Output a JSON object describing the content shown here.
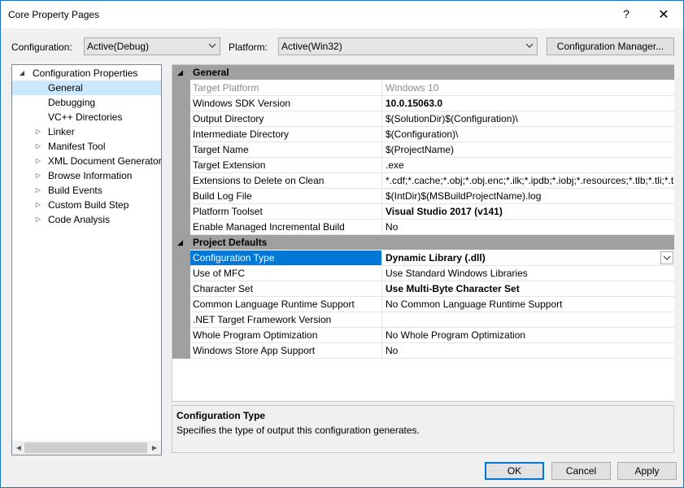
{
  "window": {
    "title": "Core Property Pages",
    "help_glyph": "?",
    "close_glyph": "✕"
  },
  "toolbar": {
    "configuration_label": "Configuration:",
    "configuration_value": "Active(Debug)",
    "platform_label": "Platform:",
    "platform_value": "Active(Win32)",
    "config_manager_label": "Configuration Manager..."
  },
  "tree": {
    "root": "Configuration Properties",
    "items": [
      {
        "label": "General",
        "selected": true,
        "expandable": false
      },
      {
        "label": "Debugging",
        "expandable": false
      },
      {
        "label": "VC++ Directories",
        "expandable": false
      },
      {
        "label": "Linker",
        "expandable": true
      },
      {
        "label": "Manifest Tool",
        "expandable": true
      },
      {
        "label": "XML Document Generator",
        "expandable": true
      },
      {
        "label": "Browse Information",
        "expandable": true
      },
      {
        "label": "Build Events",
        "expandable": true
      },
      {
        "label": "Custom Build Step",
        "expandable": true
      },
      {
        "label": "Code Analysis",
        "expandable": true
      }
    ]
  },
  "grid": {
    "categories": [
      {
        "label": "General",
        "rows": [
          {
            "name": "Target Platform",
            "value": "Windows 10",
            "disabled": true
          },
          {
            "name": "Windows SDK Version",
            "value": "10.0.15063.0",
            "bold": true
          },
          {
            "name": "Output Directory",
            "value": "$(SolutionDir)$(Configuration)\\"
          },
          {
            "name": "Intermediate Directory",
            "value": "$(Configuration)\\"
          },
          {
            "name": "Target Name",
            "value": "$(ProjectName)"
          },
          {
            "name": "Target Extension",
            "value": ".exe"
          },
          {
            "name": "Extensions to Delete on Clean",
            "value": "*.cdf;*.cache;*.obj;*.obj.enc;*.ilk;*.ipdb;*.iobj;*.resources;*.tlb;*.tli;*.t"
          },
          {
            "name": "Build Log File",
            "value": "$(IntDir)$(MSBuildProjectName).log"
          },
          {
            "name": "Platform Toolset",
            "value": "Visual Studio 2017 (v141)",
            "bold": true
          },
          {
            "name": "Enable Managed Incremental Build",
            "value": "No"
          }
        ]
      },
      {
        "label": "Project Defaults",
        "rows": [
          {
            "name": "Configuration Type",
            "value": "Dynamic Library (.dll)",
            "bold": true,
            "selected": true
          },
          {
            "name": "Use of MFC",
            "value": "Use Standard Windows Libraries"
          },
          {
            "name": "Character Set",
            "value": "Use Multi-Byte Character Set",
            "bold": true
          },
          {
            "name": "Common Language Runtime Support",
            "value": "No Common Language Runtime Support"
          },
          {
            "name": ".NET Target Framework Version",
            "value": ""
          },
          {
            "name": "Whole Program Optimization",
            "value": "No Whole Program Optimization"
          },
          {
            "name": "Windows Store App Support",
            "value": "No"
          }
        ]
      }
    ]
  },
  "description": {
    "title": "Configuration Type",
    "text": "Specifies the type of output this configuration generates."
  },
  "buttons": {
    "ok": "OK",
    "cancel": "Cancel",
    "apply": "Apply"
  },
  "icons": {
    "expanded": "◢",
    "collapsed": "▷",
    "dropdown": "chevron-down-icon"
  },
  "colors": {
    "selection": "#0078d7",
    "tree_selection": "#cce8ff",
    "category_bar": "#a0a0a0"
  }
}
